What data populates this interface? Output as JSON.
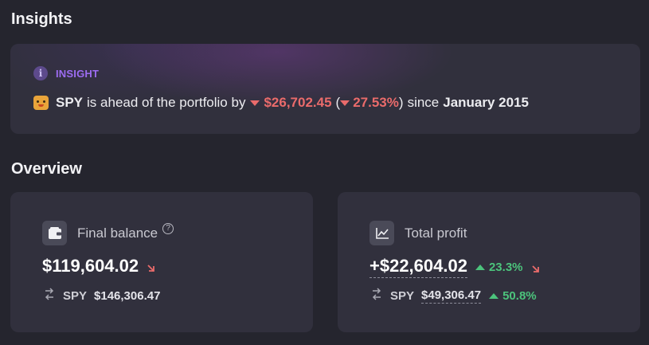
{
  "insights": {
    "title": "Insights",
    "badge": "INSIGHT",
    "ticker": "SPY",
    "text_mid": "is ahead of the portfolio by",
    "amount": "$26,702.45",
    "open_paren": "(",
    "percent": "27.53%",
    "close_paren": ")",
    "text_since": "since",
    "since_date": "January 2015",
    "colors": {
      "badge": "#9d6cf2",
      "negative": "#ea6b6b"
    }
  },
  "overview": {
    "title": "Overview",
    "final_balance": {
      "label": "Final balance",
      "help": "?",
      "value": "$119,604.02",
      "trend": "down",
      "benchmark_ticker": "SPY",
      "benchmark_value": "$146,306.47"
    },
    "total_profit": {
      "label": "Total profit",
      "value": "+$22,604.02",
      "change": "23.3%",
      "trend": "down",
      "benchmark_ticker": "SPY",
      "benchmark_value": "$49,306.47",
      "benchmark_change": "50.8%"
    },
    "colors": {
      "positive": "#4cc37c",
      "negative": "#ea6b6b",
      "card": "#31303d",
      "background": "#25252e"
    }
  },
  "icons": [
    "info-icon",
    "cat-emoji-icon",
    "wallet-icon",
    "help-icon",
    "chart-icon",
    "arrow-down-right-icon",
    "swap-icon",
    "triangle-up-icon",
    "triangle-down-icon"
  ]
}
